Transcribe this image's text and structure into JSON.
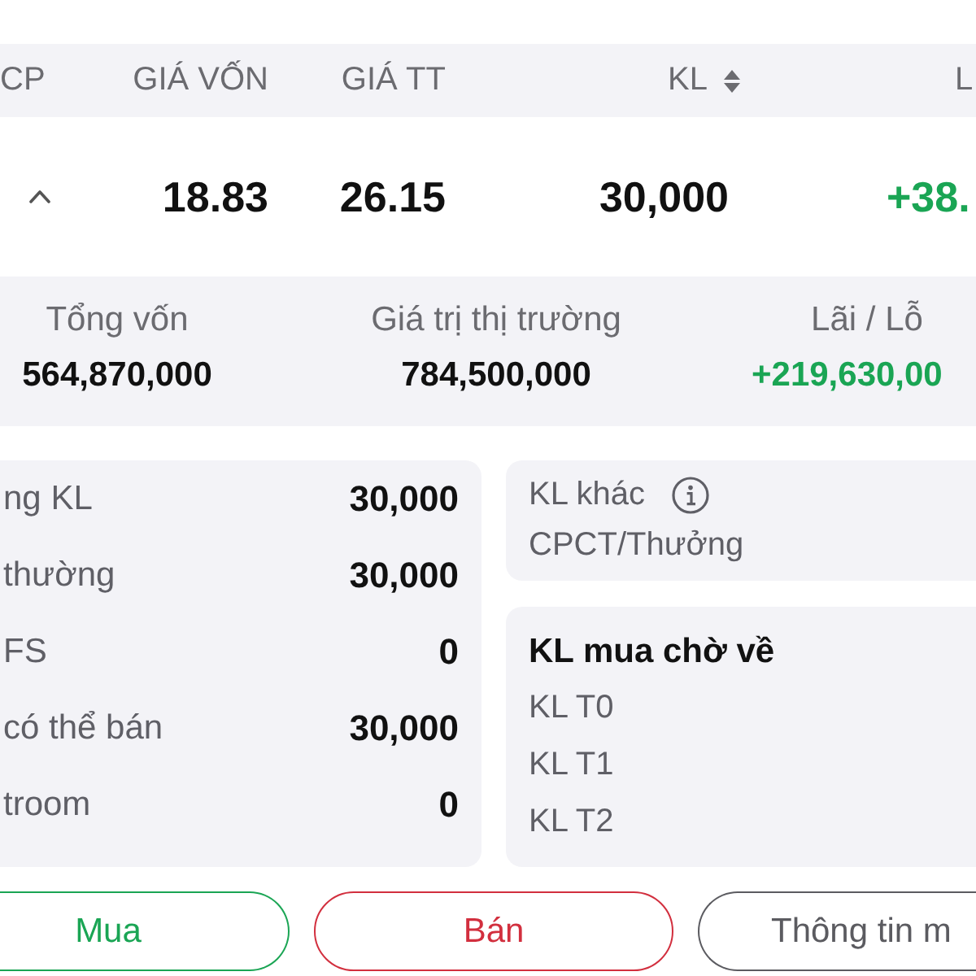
{
  "table": {
    "columns": [
      {
        "label": "CP",
        "sortable": false
      },
      {
        "label": "GIÁ VỐN",
        "sortable": false
      },
      {
        "label": "GIÁ TT",
        "sortable": false
      },
      {
        "label": "KL",
        "sortable": true
      },
      {
        "label": "L",
        "sortable": false
      }
    ],
    "rows": [
      {
        "cells": [
          {
            "kind": "toggle",
            "expanded": true
          },
          {
            "kind": "number",
            "text": "18.83"
          },
          {
            "kind": "number",
            "text": "26.15"
          },
          {
            "kind": "number",
            "text": "30,000"
          },
          {
            "kind": "gain",
            "text": "+38."
          }
        ]
      }
    ]
  },
  "summary": [
    {
      "label": "Tổng vốn",
      "value": "564,870,000",
      "kind": "number"
    },
    {
      "label": "Giá trị thị trường",
      "value": "784,500,000",
      "kind": "number"
    },
    {
      "label": "Lãi / Lỗ",
      "value": "+219,630,00",
      "kind": "gain"
    }
  ],
  "holdings": [
    {
      "label": "ng KL",
      "value": "30,000"
    },
    {
      "label": "thường",
      "value": "30,000"
    },
    {
      "label": "FS",
      "value": "0"
    },
    {
      "label": "có thể bán",
      "value": "30,000"
    },
    {
      "label": "troom",
      "value": "0"
    }
  ],
  "other_volume": {
    "title": "KL khác",
    "items": [
      "CPCT/Thưởng"
    ]
  },
  "pending_buy": {
    "title": "KL mua chờ về",
    "items": [
      "KL T0",
      "KL T1",
      "KL T2"
    ]
  },
  "buttons": [
    {
      "label": "Mua",
      "kind": "buy"
    },
    {
      "label": "Bán",
      "kind": "sell"
    },
    {
      "label": "Thông tin m",
      "kind": "info"
    }
  ]
}
